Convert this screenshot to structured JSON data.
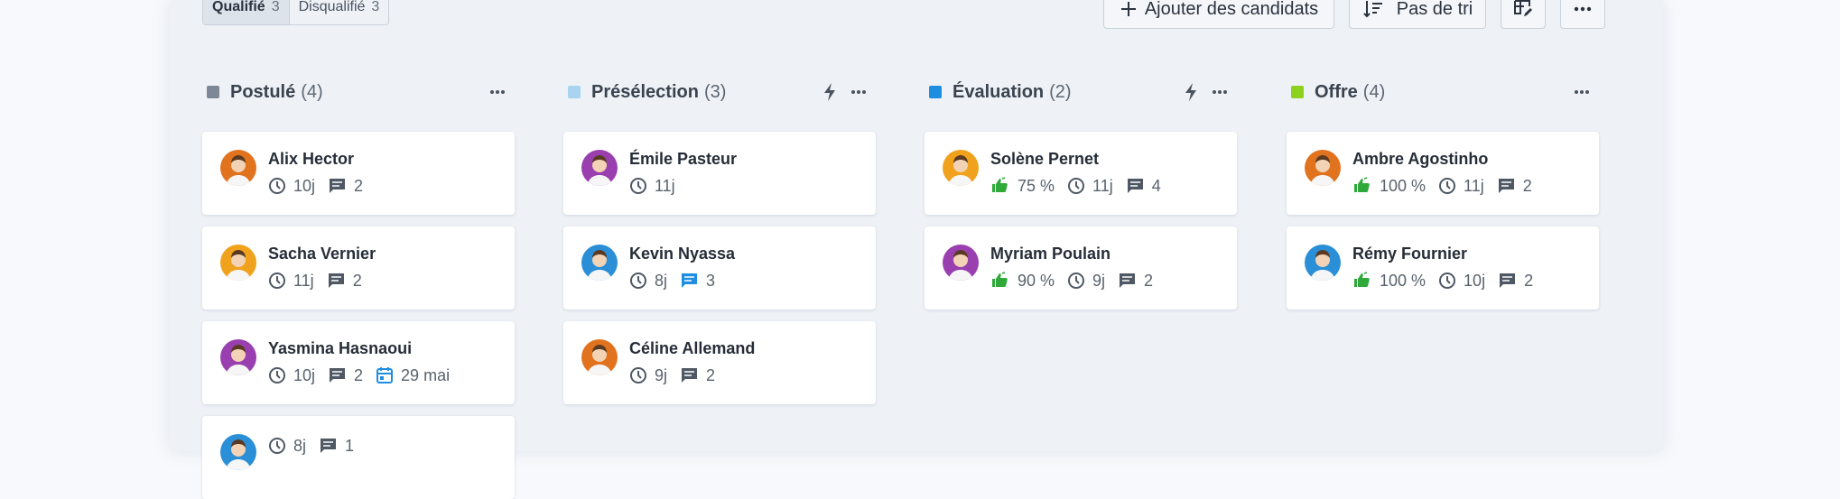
{
  "filters": [
    {
      "label": "Qualifié",
      "count": "3",
      "active": true
    },
    {
      "label": "Disqualifié",
      "count": "3",
      "active": false
    }
  ],
  "toolbar": {
    "add_label": "Ajouter des candidats",
    "sort_label": "Pas de tri"
  },
  "columns": [
    {
      "title": "Postulé",
      "count": "(4)",
      "color": "#7d8796",
      "automation": false,
      "cards": [
        {
          "name": "Alix Hector",
          "days": "10j",
          "comments": "2",
          "avatar_bg": "#e1731f"
        },
        {
          "name": "Sacha Vernier",
          "days": "11j",
          "comments": "2",
          "avatar_bg": "#f0a21c"
        },
        {
          "name": "Yasmina Hasnaoui",
          "days": "10j",
          "comments": "2",
          "date": "29 mai",
          "avatar_bg": "#9a3fb0"
        },
        {
          "name": "",
          "days": "8j",
          "comments": "1",
          "avatar_bg": "#2a8fd6"
        }
      ]
    },
    {
      "title": "Présélection",
      "count": "(3)",
      "color": "#a8d4f2",
      "automation": true,
      "cards": [
        {
          "name": "Émile Pasteur",
          "days": "11j",
          "avatar_bg": "#9a3fb0"
        },
        {
          "name": "Kevin Nyassa",
          "days": "8j",
          "comments": "3",
          "comments_highlight": true,
          "avatar_bg": "#2a8fd6"
        },
        {
          "name": "Céline Allemand",
          "days": "9j",
          "comments": "2",
          "avatar_bg": "#e1731f"
        }
      ]
    },
    {
      "title": "Évaluation",
      "count": "(2)",
      "color": "#1f8ee0",
      "automation": true,
      "cards": [
        {
          "name": "Solène Pernet",
          "score": "75 %",
          "days": "11j",
          "comments": "4",
          "avatar_bg": "#f0a21c"
        },
        {
          "name": "Myriam Poulain",
          "score": "90 %",
          "days": "9j",
          "comments": "2",
          "avatar_bg": "#9a3fb0"
        }
      ]
    },
    {
      "title": "Offre",
      "count": "(4)",
      "color": "#8dd11f",
      "automation": false,
      "cards": [
        {
          "name": "Ambre Agostinho",
          "score": "100 %",
          "days": "11j",
          "comments": "2",
          "avatar_bg": "#e1731f"
        },
        {
          "name": "Rémy Fournier",
          "score": "100 %",
          "days": "10j",
          "comments": "2",
          "avatar_bg": "#2a8fd6"
        }
      ]
    }
  ]
}
